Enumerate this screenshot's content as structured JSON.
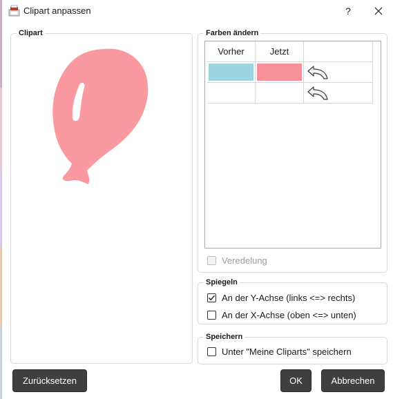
{
  "window": {
    "title": "Clipart anpassen",
    "help_label": "?"
  },
  "clipart_group": {
    "title": "Clipart",
    "image_icon": "balloon-clipart",
    "image_color": "#fa9aa0"
  },
  "colors_group": {
    "title": "Farben ändern",
    "columns": [
      "Vorher",
      "Jetzt"
    ],
    "rows": [
      {
        "before_color": "#9ed4e1",
        "after_color": "#f6919a",
        "undo_icon": "undo-arrow-icon"
      },
      {
        "before_color": "",
        "after_color": "",
        "undo_icon": "undo-arrow-icon"
      }
    ],
    "refinement_label": "Veredelung",
    "refinement_checked": false,
    "refinement_enabled": false
  },
  "mirror_group": {
    "title": "Spiegeln",
    "y_axis_label": "An der Y-Achse (links <=> rechts)",
    "y_axis_checked": true,
    "x_axis_label": "An der X-Achse (oben <=> unten)",
    "x_axis_checked": false
  },
  "save_group": {
    "title": "Speichern",
    "save_label": "Unter \"Meine Cliparts\" speichern",
    "save_checked": false
  },
  "buttons": {
    "reset": "Zurücksetzen",
    "ok": "OK",
    "cancel": "Abbrechen"
  },
  "colors": {
    "button_bg": "#3f3f3f",
    "button_text": "#ffffff",
    "group_border": "#d8d8d8"
  }
}
